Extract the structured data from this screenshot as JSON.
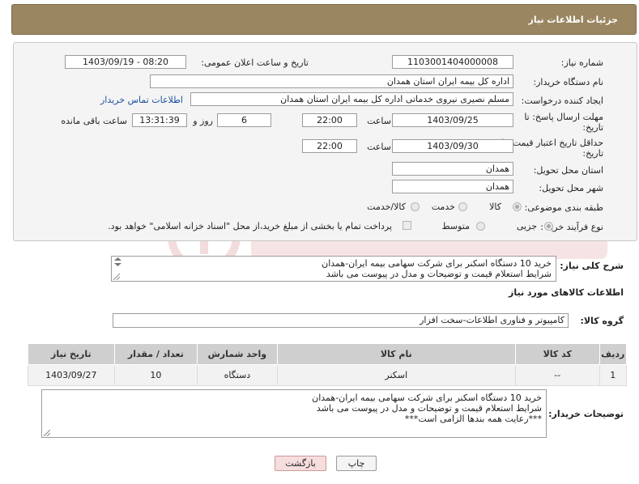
{
  "header": {
    "title": "جزئیات اطلاعات نیاز"
  },
  "form": {
    "need_number": {
      "label": "شماره نیاز:",
      "value": "1103001404000008"
    },
    "announce_datetime": {
      "label": "تاریخ و ساعت اعلان عمومی:",
      "value": "1403/09/19 - 08:20"
    },
    "buyer_org": {
      "label": "نام دستگاه خریدار:",
      "value": "اداره کل بیمه ایران استان همدان"
    },
    "requester": {
      "label": "ایجاد کننده درخواست:",
      "value": "مسلم نصیری نیروی خدماتی اداره کل بیمه ایران استان همدان",
      "contact_link": "اطلاعات تماس خریدار"
    },
    "deadline": {
      "label_line1": "مهلت ارسال پاسخ: تا",
      "label_line2": "تاریخ:",
      "date": "1403/09/25",
      "time_label": "ساعت",
      "time": "22:00",
      "days": "6",
      "days_label": "روز و",
      "remaining": "13:31:39",
      "remaining_label": "ساعت باقی مانده"
    },
    "price_validity": {
      "label_line1": "حداقل تاریخ اعتبار قیمت: تا",
      "label_line2": "تاریخ:",
      "date": "1403/09/30",
      "time_label": "ساعت",
      "time": "22:00"
    },
    "delivery_province": {
      "label": "استان محل تحویل:",
      "value": "همدان"
    },
    "delivery_city": {
      "label": "شهر محل تحویل:",
      "value": "همدان"
    },
    "category": {
      "label": "طبقه بندی موضوعی:",
      "options": [
        "کالا",
        "خدمت",
        "کالا/خدمت"
      ],
      "selected": "کالا"
    },
    "purchase_process": {
      "label": "نوع فرآیند خرید :",
      "options": [
        "جزیی",
        "متوسط"
      ],
      "selected": "جزیی",
      "payment_note": "پرداخت تمام یا بخشی از مبلغ خرید،از محل \"اسناد خزانه اسلامی\" خواهد بود."
    }
  },
  "description": {
    "label": "شرح کلی نیاز:",
    "line1": "خرید 10 دستگاه اسکنر برای شرکت سهامی بیمه ایران-همدان",
    "line2": "شرایط استعلام قیمت و توضیحات و مدل در پیوست می باشد"
  },
  "goods_section": {
    "title": "اطلاعات کالاهای مورد نیاز",
    "group_label": "گروه کالا:",
    "group_value": "کامپیوتر و فناوری اطلاعات-سخت افزار"
  },
  "table": {
    "headers": [
      "ردیف",
      "کد کالا",
      "نام کالا",
      "واحد شمارش",
      "تعداد / مقدار",
      "تاریخ نیاز"
    ],
    "rows": [
      [
        "1",
        "--",
        "اسکنر",
        "دستگاه",
        "10",
        "1403/09/27"
      ]
    ]
  },
  "buyer_notes": {
    "label": "توضیحات خریدار:",
    "line1": "خرید 10 دستگاه اسکنر برای شرکت سهامی بیمه ایران-همدان",
    "line2": "شرایط استعلام قیمت و توضیحات و مدل در پیوست می باشد",
    "line3": "***رعایت همه بندها الزامی است***"
  },
  "buttons": {
    "print": "چاپ",
    "back": "بازگشت"
  },
  "colors": {
    "header_bg": "#9a8660",
    "back_button_bg": "#f7dede",
    "watermark": "#e6b3b3"
  }
}
